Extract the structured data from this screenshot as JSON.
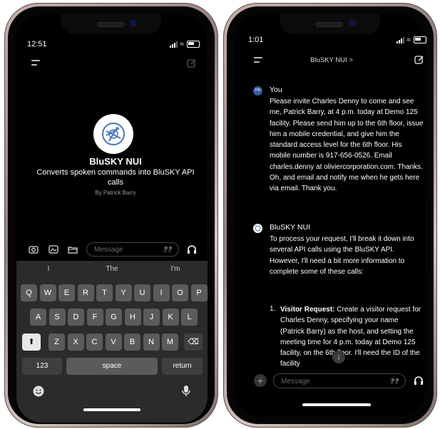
{
  "phone1": {
    "status_time": "12:51",
    "bot": {
      "name": "BluSKY NUI",
      "description": "Converts spoken commands into BluSKY API calls",
      "byline": "By Patrick Barry"
    },
    "input": {
      "placeholder": "Message"
    },
    "keyboard": {
      "suggestions": [
        "I",
        "The",
        "I'm"
      ],
      "row1": [
        "Q",
        "W",
        "E",
        "R",
        "T",
        "Y",
        "U",
        "I",
        "O",
        "P"
      ],
      "row2": [
        "A",
        "S",
        "D",
        "F",
        "G",
        "H",
        "J",
        "K",
        "L"
      ],
      "row3": [
        "Z",
        "X",
        "C",
        "V",
        "B",
        "N",
        "M"
      ],
      "numbers_label": "123",
      "space_label": "space",
      "return_label": "return"
    }
  },
  "phone2": {
    "status_time": "1:01",
    "header_title": "BluSKY NUI >",
    "user": {
      "avatar_initials": "PB",
      "name": "You",
      "message": "Please invite Charles Denny to come and see me, Patrick Barry, at 4 p.m. today at Demo 125 facility. Please send him up to the 6th floor, issue him a mobile credential, and give him the standard access level for the 6th floor. His mobile number is 917-656-0526. Email charles.denny at oliviercorporation.com. Thanks. Oh, and email and notify me when he gets here via email. Thank you."
    },
    "bot": {
      "name": "BluSKY NUI",
      "message": "To process your request, I'll break it down into several API calls using the BluSKY API. However, I'll need a bit more information to complete some of these calls:",
      "list_item_number": "1.",
      "list_item_title": "Visitor Request:",
      "list_item_text": "Create a visitor request for Charles Denny, specifying your name (Patrick Barry) as the host, and setting the meeting time for 4 p.m. today at Demo 125 facility, on the 6th floor. I'll need the ID of the facility"
    },
    "input": {
      "placeholder": "Message"
    }
  }
}
